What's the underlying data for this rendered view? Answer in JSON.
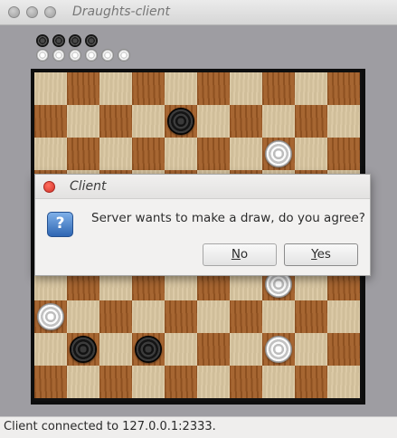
{
  "window": {
    "title": "Draughts-client"
  },
  "captured_pieces": {
    "black_count": 4,
    "white_count": 6
  },
  "board": {
    "size": 10,
    "light_color": "#d9c6a0",
    "dark_color": "#a15c25",
    "pieces": [
      {
        "row": 1,
        "col": 4,
        "color": "black"
      },
      {
        "row": 2,
        "col": 7,
        "color": "white"
      },
      {
        "row": 6,
        "col": 7,
        "color": "white"
      },
      {
        "row": 7,
        "col": 0,
        "color": "white"
      },
      {
        "row": 8,
        "col": 1,
        "color": "black"
      },
      {
        "row": 8,
        "col": 3,
        "color": "black"
      },
      {
        "row": 8,
        "col": 7,
        "color": "white"
      }
    ]
  },
  "dialog": {
    "title": "Client",
    "icon": "question-icon",
    "icon_glyph": "?",
    "message": "Server wants to make a draw, do you agree?",
    "buttons": {
      "no": {
        "mnemonic": "N",
        "rest": "o"
      },
      "yes": {
        "mnemonic": "Y",
        "rest": "es"
      }
    }
  },
  "status": {
    "text": "Client connected to 127.0.0.1:2333."
  }
}
